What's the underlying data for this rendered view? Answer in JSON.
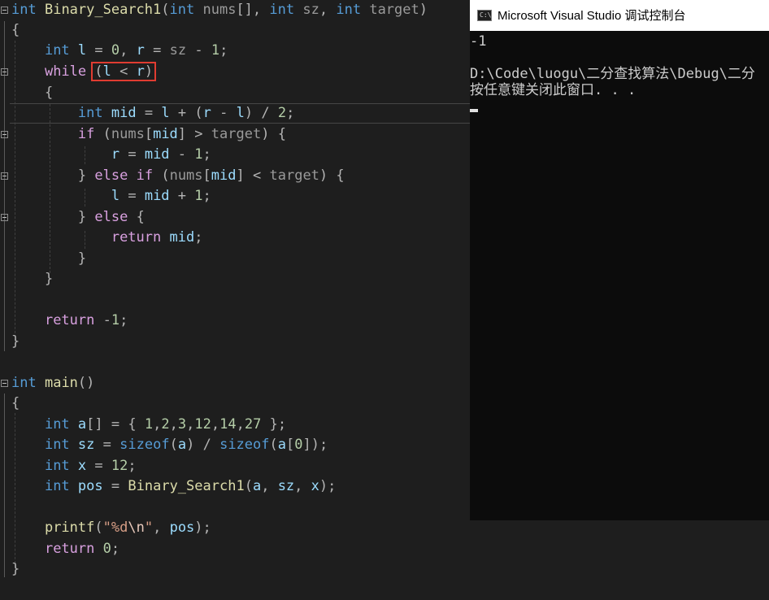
{
  "editor": {
    "highlighted_condition": "(l < r)",
    "lines": [
      {
        "id": "l1",
        "t": "int Binary_Search1(int nums[], int sz, int target)"
      },
      {
        "id": "l2",
        "t": "{"
      },
      {
        "id": "l3",
        "t": "    int l = 0, r = sz - 1;"
      },
      {
        "id": "l4",
        "t": "    while (l < r)"
      },
      {
        "id": "l5",
        "t": "    {"
      },
      {
        "id": "l6",
        "t": "        int mid = l + (r - l) / 2;"
      },
      {
        "id": "l7",
        "t": "        if (nums[mid] > target) {"
      },
      {
        "id": "l8",
        "t": "            r = mid - 1;"
      },
      {
        "id": "l9",
        "t": "        } else if (nums[mid] < target) {"
      },
      {
        "id": "l10",
        "t": "            l = mid + 1;"
      },
      {
        "id": "l11",
        "t": "        } else {"
      },
      {
        "id": "l12",
        "t": "            return mid;"
      },
      {
        "id": "l13",
        "t": "        }"
      },
      {
        "id": "l14",
        "t": "    }"
      },
      {
        "id": "l15",
        "t": ""
      },
      {
        "id": "l16",
        "t": "    return -1;"
      },
      {
        "id": "l17",
        "t": "}"
      },
      {
        "id": "l18",
        "t": ""
      },
      {
        "id": "l19",
        "t": "int main()"
      },
      {
        "id": "l20",
        "t": "{"
      },
      {
        "id": "l21",
        "t": "    int a[] = { 1,2,3,12,14,27 };"
      },
      {
        "id": "l22",
        "t": "    int sz = sizeof(a) / sizeof(a[0]);"
      },
      {
        "id": "l23",
        "t": "    int x = 12;"
      },
      {
        "id": "l24",
        "t": "    int pos = Binary_Search1(a, sz, x);"
      },
      {
        "id": "l25",
        "t": ""
      },
      {
        "id": "l26",
        "t": "    printf(\"%d\\n\", pos);"
      },
      {
        "id": "l27",
        "t": "    return 0;"
      },
      {
        "id": "l28",
        "t": "}"
      }
    ]
  },
  "console": {
    "title": "Microsoft Visual Studio 调试控制台",
    "icon_label": "C:\\",
    "output": [
      "-1",
      "",
      "D:\\Code\\luogu\\二分查找算法\\Debug\\二分",
      "按任意键关闭此窗口. . ."
    ]
  },
  "colors": {
    "background": "#1e1e1e",
    "keyword": "#569cd6",
    "control_keyword": "#d8a0df",
    "function": "#dcdcaa",
    "variable": "#9cdcfe",
    "parameter": "#9a9a9a",
    "number": "#b5cea8",
    "string": "#d69d85",
    "highlight_box": "#e03c31",
    "console_bg": "#0c0c0c",
    "console_text": "#cccccc"
  }
}
